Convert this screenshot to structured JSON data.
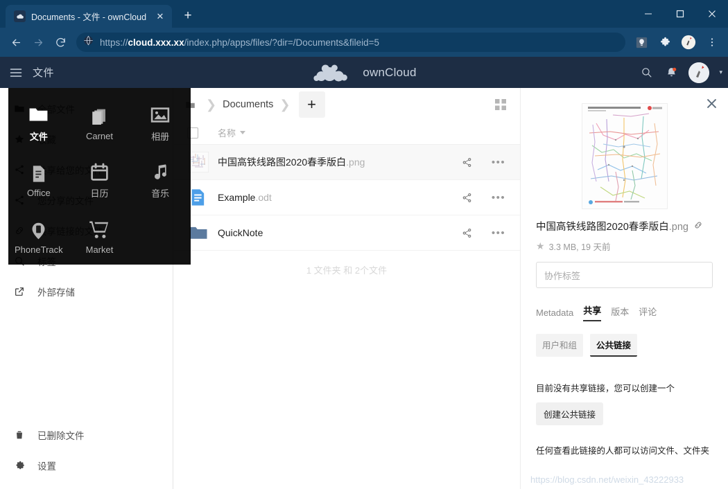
{
  "browser": {
    "tab": {
      "title": "Documents - 文件 - ownCloud",
      "favicon_name": "owncloud-favicon",
      "close_label": "✕"
    },
    "newtab_label": "+",
    "window": {
      "minimize": "—",
      "maximize": "▢",
      "close": "✕"
    },
    "nav": {
      "back": "←",
      "forward": "→",
      "reload": "⟳"
    },
    "omnibox": {
      "scheme": "https://",
      "host": "cloud.xxx.xx",
      "path": "/index.php/apps/files/?dir=/Documents&fileid=5",
      "full_url": "https://cloud.xxx.xx/index.php/apps/files/?dir=/Documents&fileid=5",
      "site_icon_name": "globe-icon"
    },
    "extensions": [
      "lightbulb-icon",
      "puzzle-piece-icon",
      "profile-avatar",
      "kebab-menu-icon"
    ]
  },
  "oc_header": {
    "menu_icon": "hamburger-icon",
    "app_title": "文件",
    "brand": "ownCloud",
    "search_icon": "search-icon",
    "notifications_icon": "bell-icon",
    "avatar_name": "user-avatar",
    "caret": "▾"
  },
  "app_drawer": {
    "items": [
      {
        "label": "文件",
        "icon": "folder-icon",
        "active": true
      },
      {
        "label": "Carnet",
        "icon": "notes-stack-icon",
        "active": false
      },
      {
        "label": "相册",
        "icon": "photo-icon",
        "active": false
      },
      {
        "label": "Office",
        "icon": "document-icon",
        "active": false
      },
      {
        "label": "日历",
        "icon": "calendar-icon",
        "active": false
      },
      {
        "label": "音乐",
        "icon": "music-note-icon",
        "active": false
      },
      {
        "label": "PhoneTrack",
        "icon": "phone-pin-icon",
        "active": false
      },
      {
        "label": "Market",
        "icon": "shopping-cart-icon",
        "active": false
      }
    ]
  },
  "sidebar": {
    "items": [
      {
        "label": "全部文件",
        "icon": "folder-icon"
      },
      {
        "label": "收藏",
        "icon": "star-icon"
      },
      {
        "label": "共享给您的文件",
        "icon": "share-icon"
      },
      {
        "label": "您分享的文件",
        "icon": "share-icon"
      },
      {
        "label": "共享链接的文件",
        "icon": "link-icon"
      },
      {
        "label": "标签",
        "icon": "search-tag-icon"
      },
      {
        "label": "外部存储",
        "icon": "external-storage-icon"
      }
    ],
    "bottom_items": [
      {
        "label": "已删除文件",
        "icon": "trash-icon"
      },
      {
        "label": "设置",
        "icon": "gear-icon"
      }
    ]
  },
  "files": {
    "breadcrumb": {
      "home_icon": "home-icon",
      "separator": "❯",
      "current": "Documents",
      "add_label": "+"
    },
    "grid_toggle_icon": "grid-view-icon",
    "header": {
      "select_all": "select-all-checkbox",
      "name_column": "名称",
      "sort_caret": "▾"
    },
    "rows": [
      {
        "name": "中国高铁线路图2020春季版白",
        "ext": ".png",
        "type": "image",
        "selected": true,
        "share_icon": "share-icon",
        "more_icon": "more-actions-icon"
      },
      {
        "name": "Example",
        "ext": ".odt",
        "type": "document",
        "selected": false,
        "share_icon": "share-icon",
        "more_icon": "more-actions-icon"
      },
      {
        "name": "QuickNote",
        "ext": "",
        "type": "folder",
        "selected": false,
        "share_icon": "share-icon",
        "more_icon": "more-actions-icon"
      }
    ],
    "summary": "1 文件夹 和 2个文件"
  },
  "details": {
    "close_icon": "close-icon",
    "preview_name": "railway-map-preview",
    "filename": "中国高铁线路图2020春季版白",
    "file_ext": ".png",
    "link_icon": "link-icon",
    "star_icon": "star-icon",
    "meta": "3.3 MB, 19 天前",
    "tags_placeholder": "协作标签",
    "tabs": [
      {
        "label": "Metadata",
        "active": false
      },
      {
        "label": "共享",
        "active": true
      },
      {
        "label": "版本",
        "active": false
      },
      {
        "label": "评论",
        "active": false
      }
    ],
    "subtabs": [
      {
        "label": "用户和组",
        "active": false
      },
      {
        "label": "公共链接",
        "active": true
      }
    ],
    "no_link_note": "目前没有共享链接，您可以创建一个",
    "create_link_button": "创建公共链接",
    "access_note": "任何查看此链接的人都可以访问文件、文件夹"
  },
  "watermark": "https://blog.csdn.net/weixin_43222933",
  "colors": {
    "browser_chrome": "#0d3c61",
    "browser_toolbar": "#16476f",
    "oc_header": "#1d2d44",
    "folder_blue": "#5b7a9e",
    "doc_blue": "#4d9fe8"
  }
}
